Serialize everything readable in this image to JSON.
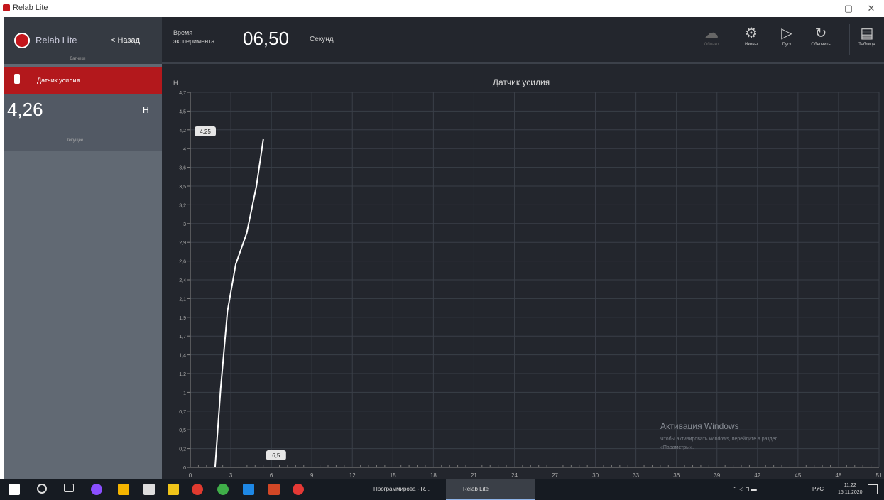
{
  "window": {
    "title": "Relab Lite",
    "minimize": "–",
    "maximize": "▢",
    "close": "✕"
  },
  "sidebar": {
    "app_name": "Relab Lite",
    "back_label": "< Назад",
    "subtitle": "Датчики",
    "sensor_tab_label": "Датчик усилия",
    "sensor_value": "4,26",
    "sensor_unit": "Н",
    "sensor_caption": "текущее"
  },
  "toolbar": {
    "time_label": "Время эксперимента",
    "time_value": "06,50",
    "time_unit": "Секунд",
    "buttons": [
      {
        "icon": "cloud-icon",
        "label": "Облако"
      },
      {
        "icon": "sensors-icon",
        "label": "Иконы"
      },
      {
        "icon": "play-icon",
        "label": "Пуск"
      },
      {
        "icon": "refresh-icon",
        "label": "Обновить"
      },
      {
        "icon": "table-icon",
        "label": "Таблица"
      }
    ]
  },
  "chart_data": {
    "type": "line",
    "title": "Датчик усилия",
    "ylabel": "Н",
    "xlabel": "",
    "xlim": [
      0,
      50
    ],
    "ylim": [
      0,
      4.8
    ],
    "y_ticks": [
      "0",
      "0,2",
      "0,5",
      "0,7",
      "1",
      "1,2",
      "1,4",
      "1,7",
      "1,9",
      "2,1",
      "2,4",
      "2,6",
      "2,9",
      "3",
      "3,2",
      "3,5",
      "3,6",
      "4",
      "4,2",
      "4,5",
      "4,7"
    ],
    "x_ticks": [
      0,
      3,
      6,
      9,
      12,
      15,
      18,
      21,
      24,
      27,
      30,
      33,
      36,
      39,
      42,
      45,
      48,
      51
    ],
    "grid": true,
    "line_color": "#ffffff",
    "series": [
      {
        "x": [
          1.8,
          2.2,
          2.7,
          3.3,
          4.1,
          4.8,
          5.3
        ],
        "y": [
          0.0,
          1.0,
          2.0,
          2.6,
          3.0,
          3.6,
          4.2
        ]
      }
    ],
    "markers": [
      {
        "label": "4,25"
      },
      {
        "label": "6,5"
      }
    ]
  },
  "watermark": {
    "title": "Активация Windows",
    "line1": "Чтобы активировать Windows, перейдите в раздел",
    "line2": "«Параметры»."
  },
  "taskbar": {
    "apps": [
      {
        "name": "start-icon"
      },
      {
        "name": "search-icon"
      },
      {
        "name": "task-view-icon"
      },
      {
        "name": "app-icon-1"
      },
      {
        "name": "app-icon-2"
      },
      {
        "name": "calculator-icon"
      },
      {
        "name": "explorer-icon"
      },
      {
        "name": "opera-icon"
      },
      {
        "name": "chrome-icon"
      },
      {
        "name": "store-icon"
      },
      {
        "name": "powerpoint-icon"
      },
      {
        "name": "yandex-icon"
      }
    ],
    "task1_label": "Программирова - R...",
    "task2_label": "Relab Lite",
    "tray_lang": "РУС",
    "clock_time": "11:22",
    "clock_date": "15.11.2020"
  }
}
